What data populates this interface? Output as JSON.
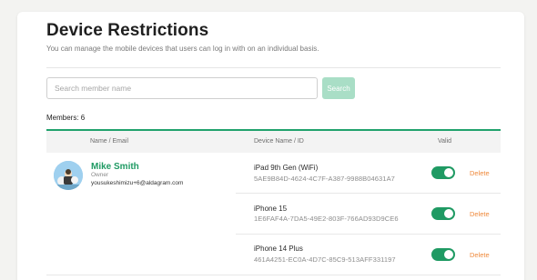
{
  "page": {
    "title": "Device Restrictions",
    "description": "You can manage the mobile devices that users can log in with on an individual basis."
  },
  "search": {
    "placeholder": "Search member name",
    "button_label": "Search"
  },
  "members": {
    "count_label": "Members: 6"
  },
  "table": {
    "headers": [
      "Name / Email",
      "Device Name / ID",
      "Valid"
    ]
  },
  "user": {
    "name": "Mike Smith",
    "role": "Owner",
    "email": "yousukeshimizu+6@aldagram.com"
  },
  "devices": [
    {
      "name": "iPad 9th Gen (WiFi)",
      "id": "5AE9B84D-4624-4C7F-A387-9988B04631A7",
      "valid": true,
      "delete_label": "Delete"
    },
    {
      "name": "iPhone 15",
      "id": "1E6FAF4A-7DA5-49E2-803F-766AD93D9CE6",
      "valid": true,
      "delete_label": "Delete"
    },
    {
      "name": "iPhone 14 Plus",
      "id": "461A4251-EC0A-4D7C-85C9-513AFF331197",
      "valid": true,
      "delete_label": "Delete"
    }
  ],
  "colors": {
    "accent": "#1f9a63",
    "delete": "#ef8a3c",
    "search_button": "#a9dec6"
  }
}
